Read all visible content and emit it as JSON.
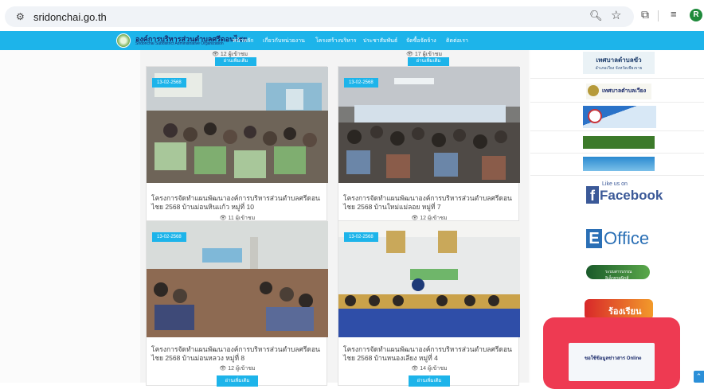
{
  "browser": {
    "url": "sridonchai.go.th",
    "profile_initial": "R"
  },
  "site": {
    "title": "องค์การบริหารส่วนตำบลศรีดอนไชย",
    "subtitle": "Sridonchai Subdistrict Administrative Organization",
    "nav": [
      "หน้าหลัก",
      "เกี่ยวกับหน่วยงาน",
      "โครงสร้างบริหาร",
      "ประชาสัมพันธ์",
      "จัดซื้อจัดจ้าง",
      "ติดต่อเรา"
    ]
  },
  "top_strip": [
    {
      "views": "12 ผู้เข้าชม",
      "button": "อ่านเพิ่มเติม"
    },
    {
      "views": "17 ผู้เข้าชม",
      "button": "อ่านเพิ่มเติม"
    }
  ],
  "cards": [
    {
      "date": "13-02-2568",
      "title": "โครงการจัดทำแผนพัฒนาองค์การบริหารส่วนตำบลศรีดอนไชย 2568 บ้านม่อนหินแก้ว หมู่ที่ 10",
      "views": "11 ผู้เข้าชม"
    },
    {
      "date": "13-02-2568",
      "title": "โครงการจัดทำแผนพัฒนาองค์การบริหารส่วนตำบลศรีดอนไชย 2568 บ้านใหม่แม่ลอย หมู่ที่ 7",
      "views": "12 ผู้เข้าชม"
    },
    {
      "date": "13-02-2568",
      "title": "โครงการจัดทำแผนพัฒนาองค์การบริหารส่วนตำบลศรีดอนไชย 2568 บ้านม่อนหลวง หมู่ที่ 8",
      "views": "12 ผู้เข้าชม",
      "button": "อ่านเพิ่มเติม"
    },
    {
      "date": "13-02-2568",
      "title": "โครงการจัดทำแผนพัฒนาองค์การบริหารส่วนตำบลศรีดอนไชย 2568 บ้านหนองเลียง หมู่ที่ 4",
      "views": "14 ผู้เข้าชม",
      "button": "อ่านเพิ่มเติม"
    }
  ],
  "sidebar": {
    "banner1_title": "เทศบาลตำบลขัว",
    "banner1_sub": "อำเภอเวียง จังหวัดเชียงราย",
    "banner2_title": "เทศบาลตำบลเวียง",
    "facebook_like": "Like us on",
    "facebook_word": "Facebook",
    "eoffice_letter": "E",
    "eoffice_word": "Office",
    "banner_green": "ระบบสารบรรณอิเล็กทรอนิกส์",
    "complaint": "ร้องเรียน",
    "popup_text": "ขอใช้ข้อมูลข่าวสาร Online"
  },
  "colors": {
    "accent": "#1db4ea",
    "popup": "#ee3a52"
  }
}
